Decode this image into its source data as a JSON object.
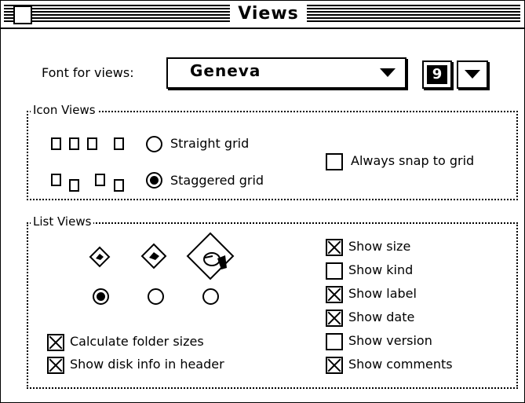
{
  "window": {
    "title": "Views"
  },
  "font": {
    "label": "Font for views:",
    "value": "Geneva",
    "size": "9"
  },
  "icon_views": {
    "title": "Icon Views",
    "straight_label": "Straight grid",
    "staggered_label": "Staggered grid",
    "selected": "staggered",
    "snap_label": "Always snap to grid",
    "snap_checked": false
  },
  "list_views": {
    "title": "List Views",
    "selected_icon_size": "small",
    "calc_label": "Calculate folder sizes",
    "calc_checked": true,
    "disk_label": "Show disk info in header",
    "disk_checked": true,
    "options": [
      {
        "label": "Show size",
        "checked": true
      },
      {
        "label": "Show kind",
        "checked": false
      },
      {
        "label": "Show label",
        "checked": true
      },
      {
        "label": "Show date",
        "checked": true
      },
      {
        "label": "Show version",
        "checked": false
      },
      {
        "label": "Show comments",
        "checked": true
      }
    ]
  }
}
